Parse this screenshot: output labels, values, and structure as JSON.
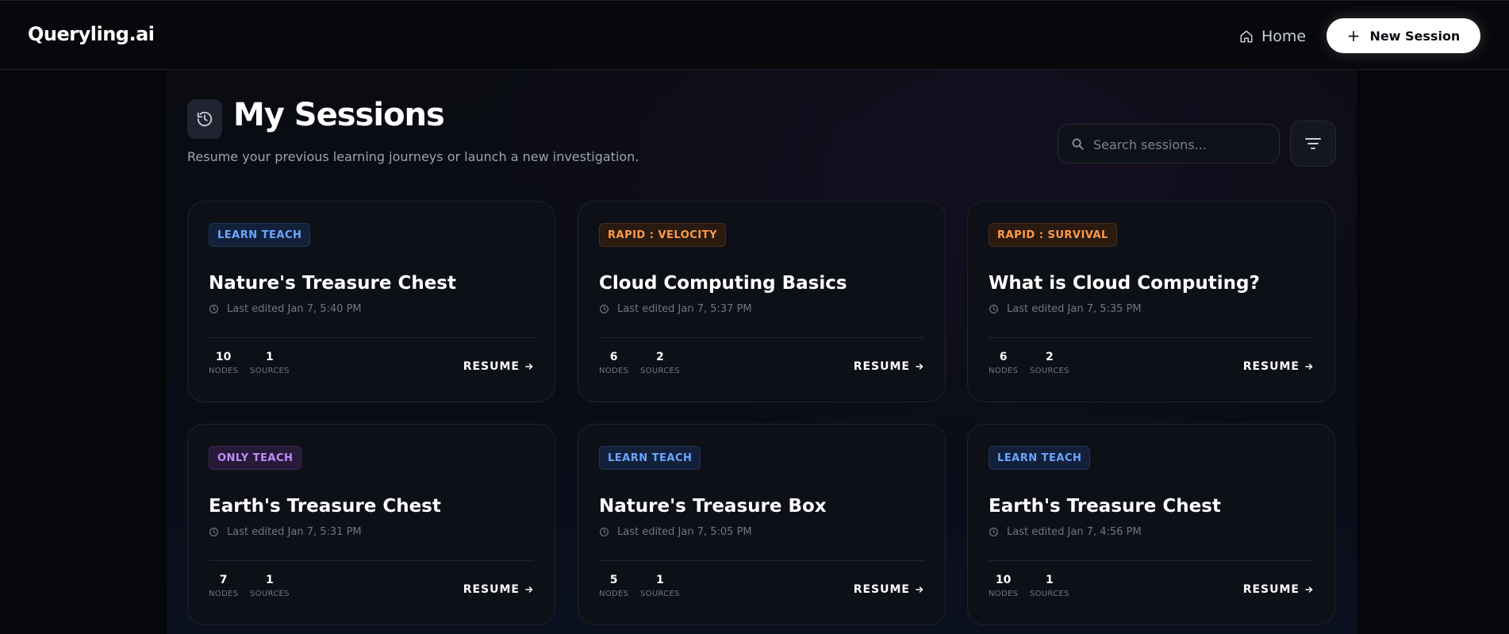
{
  "header": {
    "brand": "Queryling.ai",
    "home_label": "Home",
    "new_session_label": "New Session"
  },
  "page": {
    "title": "My Sessions",
    "subtitle": "Resume your previous learning journeys or launch a new investigation.",
    "search_placeholder": "Search sessions..."
  },
  "labels": {
    "nodes": "NODES",
    "sources": "SOURCES",
    "resume": "RESUME"
  },
  "colors": {
    "badge_blue": "#6aa6ff",
    "badge_orange": "#ff9a4a",
    "badge_purple": "#c08cff",
    "accent_button": "#ffffff"
  },
  "sessions": [
    {
      "badge": "LEARN TEACH",
      "badge_color": "blue",
      "title": "Nature's Treasure Chest",
      "edited": "Last edited Jan 7, 5:40 PM",
      "nodes": "10",
      "sources": "1"
    },
    {
      "badge": "RAPID : VELOCITY",
      "badge_color": "orange",
      "title": "Cloud Computing Basics",
      "edited": "Last edited Jan 7, 5:37 PM",
      "nodes": "6",
      "sources": "2"
    },
    {
      "badge": "RAPID : SURVIVAL",
      "badge_color": "orange",
      "title": "What is Cloud Computing?",
      "edited": "Last edited Jan 7, 5:35 PM",
      "nodes": "6",
      "sources": "2"
    },
    {
      "badge": "ONLY TEACH",
      "badge_color": "purple",
      "title": "Earth's Treasure Chest",
      "edited": "Last edited Jan 7, 5:31 PM",
      "nodes": "7",
      "sources": "1"
    },
    {
      "badge": "LEARN TEACH",
      "badge_color": "blue",
      "title": "Nature's Treasure Box",
      "edited": "Last edited Jan 7, 5:05 PM",
      "nodes": "5",
      "sources": "1"
    },
    {
      "badge": "LEARN TEACH",
      "badge_color": "blue",
      "title": "Earth's Treasure Chest",
      "edited": "Last edited Jan 7, 4:56 PM",
      "nodes": "10",
      "sources": "1"
    }
  ]
}
